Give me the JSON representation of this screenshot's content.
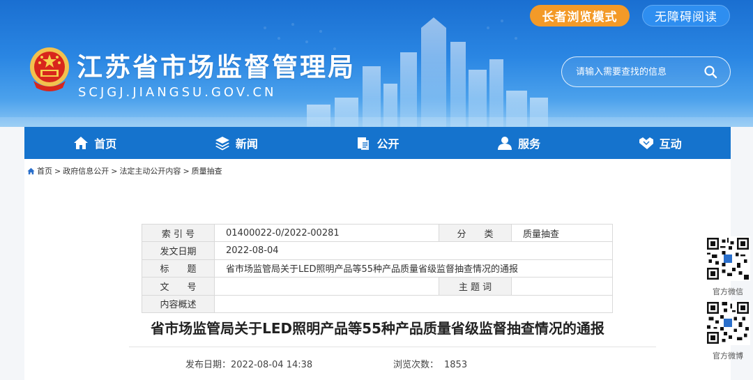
{
  "header": {
    "elder_mode_label": "长者浏览模式",
    "accessible_label": "无障碍阅读",
    "site_title": "江苏省市场监督管理局",
    "site_domain": "SCJGJ.JIANGSU.GOV.CN",
    "search_placeholder": "请输入需要查找的信息"
  },
  "nav": {
    "items": [
      {
        "label": "首页",
        "icon": "home-icon"
      },
      {
        "label": "新闻",
        "icon": "layers-icon"
      },
      {
        "label": "公开",
        "icon": "open-file-icon"
      },
      {
        "label": "服务",
        "icon": "users-icon"
      },
      {
        "label": "互动",
        "icon": "handshake-icon"
      }
    ]
  },
  "breadcrumb": {
    "items": [
      "首页",
      "政府信息公开",
      "法定主动公开内容",
      "质量抽查"
    ],
    "separator": ">"
  },
  "meta": {
    "index_label": "索 引 号",
    "index_value": "01400022-0/2022-00281",
    "category_label": "分　　类",
    "category_value": "质量抽查",
    "date_label": "发文日期",
    "date_value": "2022-08-04",
    "title_label": "标　　题",
    "title_value": "省市场监管局关于LED照明产品等55种产品质量省级监督抽查情况的通报",
    "docno_label": "文　　号",
    "docno_value": "",
    "keywords_label": "主 题 词",
    "keywords_value": "",
    "summary_label": "内容概述",
    "summary_value": ""
  },
  "article": {
    "title": "省市场监管局关于LED照明产品等55种产品质量省级监督抽查情况的通报",
    "publish_label": "发布日期：",
    "publish_value": "2022-08-04 14:38",
    "views_label": "浏览次数：",
    "views_value": "1853"
  },
  "sidebar": {
    "wechat_label": "官方微信",
    "weibo_label": "官方微博"
  },
  "colors": {
    "nav_bg": "#1573cd",
    "elder_btn": "#f39a28",
    "header_top": "#1a6fd1"
  }
}
